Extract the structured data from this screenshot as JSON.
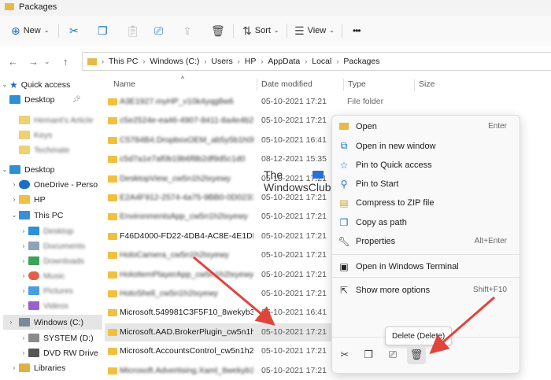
{
  "window": {
    "title": "Packages"
  },
  "toolbar": {
    "new_label": "New",
    "sort_label": "Sort",
    "view_label": "View",
    "more": "•••"
  },
  "address": {
    "crumbs": [
      "This PC",
      "Windows (C:)",
      "Users",
      "HP",
      "AppData",
      "Local",
      "Packages"
    ],
    "back": "←",
    "forward": "→",
    "up": "↑"
  },
  "nav": {
    "quick_access": "Quick access",
    "desktop": "Desktop",
    "qa_blur": [
      "Hemant's Article",
      "Keys",
      "Techmate"
    ],
    "desktop_root": "Desktop",
    "onedrive": "OneDrive - Perso",
    "hp": "HP",
    "this_pc": "This PC",
    "pc_blur": [
      "Desktop",
      "Documents",
      "Downloads",
      "Music",
      "Pictures",
      "Videos"
    ],
    "windows_c": "Windows (C:)",
    "system_d": "SYSTEM (D:)",
    "dvd": "DVD RW Drive",
    "libraries": "Libraries"
  },
  "columns": {
    "name": "Name",
    "date": "Date modified",
    "type": "Type",
    "size": "Size"
  },
  "files": [
    {
      "name": "A3E1927.myHP_v10k4yqg8w6",
      "date": "05-10-2021 17:21",
      "type": "File folder",
      "blur": true
    },
    {
      "name": "c5e2524e-ea46-4907-8411-8a4e4b2b...",
      "date": "05-10-2021 17:21",
      "type": "",
      "blur": true
    },
    {
      "name": "C5784B4.DropboxOEM_ab5y5b1h0ky",
      "date": "05-10-2021 16:41",
      "type": "",
      "blur": true
    },
    {
      "name": "c5d7a1e7af0b19b6f8b2df9d5c1d0",
      "date": "08-12-2021 15:35",
      "type": "",
      "blur": true
    },
    {
      "name": "DesktopView_cw5n1h2txyewy",
      "date": "05-10-2021 17:21",
      "type": "",
      "blur": true
    },
    {
      "name": "E2A4F912-2574-4a75-9BB0-0D023378A...",
      "date": "05-10-2021 17:21",
      "type": "",
      "blur": true
    },
    {
      "name": "EnvironmentsApp_cw5n1h2txyewy",
      "date": "05-10-2021 17:21",
      "type": "",
      "blur": true
    },
    {
      "name": "F46D4000-FD22-4DB4-AC8E-4E1DDDE8...",
      "date": "05-10-2021 17:21",
      "type": "",
      "blur": false
    },
    {
      "name": "HoloCamera_cw5n1h2txyewy",
      "date": "05-10-2021 17:21",
      "type": "",
      "blur": true
    },
    {
      "name": "HoloItemPlayerApp_cw5n1h2txyewy",
      "date": "05-10-2021 17:21",
      "type": "",
      "blur": true
    },
    {
      "name": "HoloShell_cw5n1h2txyewy",
      "date": "05-10-2021 17:21",
      "type": "",
      "blur": true
    },
    {
      "name": "Microsoft.549981C3F5F10_8wekyb3d8bb...",
      "date": "05-10-2021 16:41",
      "type": "",
      "blur": false
    },
    {
      "name": "Microsoft.AAD.BrokerPlugin_cw5n1h2txy...",
      "date": "05-10-2021 17:21",
      "type": "",
      "blur": false
    },
    {
      "name": "Microsoft.AccountsControl_cw5n1h2txyewy",
      "date": "05-10-2021 17:21",
      "type": "",
      "blur": false
    },
    {
      "name": "Microsoft.Advertising.Xaml_8wekyb3d8bbwe",
      "date": "05-10-2021 17:21",
      "type": "",
      "blur": true
    }
  ],
  "menu": {
    "items": [
      {
        "label": "Open",
        "shortcut": "Enter"
      },
      {
        "label": "Open in new window",
        "shortcut": ""
      },
      {
        "label": "Pin to Quick access",
        "shortcut": ""
      },
      {
        "label": "Pin to Start",
        "shortcut": ""
      },
      {
        "label": "Compress to ZIP file",
        "shortcut": ""
      },
      {
        "label": "Copy as path",
        "shortcut": ""
      },
      {
        "label": "Properties",
        "shortcut": "Alt+Enter"
      }
    ],
    "terminal": "Open in Windows Terminal",
    "more_options": {
      "label": "Show more options",
      "shortcut": "Shift+F10"
    },
    "tooltip": "Delete (Delete)"
  },
  "watermark": {
    "line1": "The",
    "line2": "WindowsClub"
  },
  "colors": {
    "accent": "#1a6fc4",
    "folder": "#f0c040",
    "arrow": "#e0443a"
  }
}
